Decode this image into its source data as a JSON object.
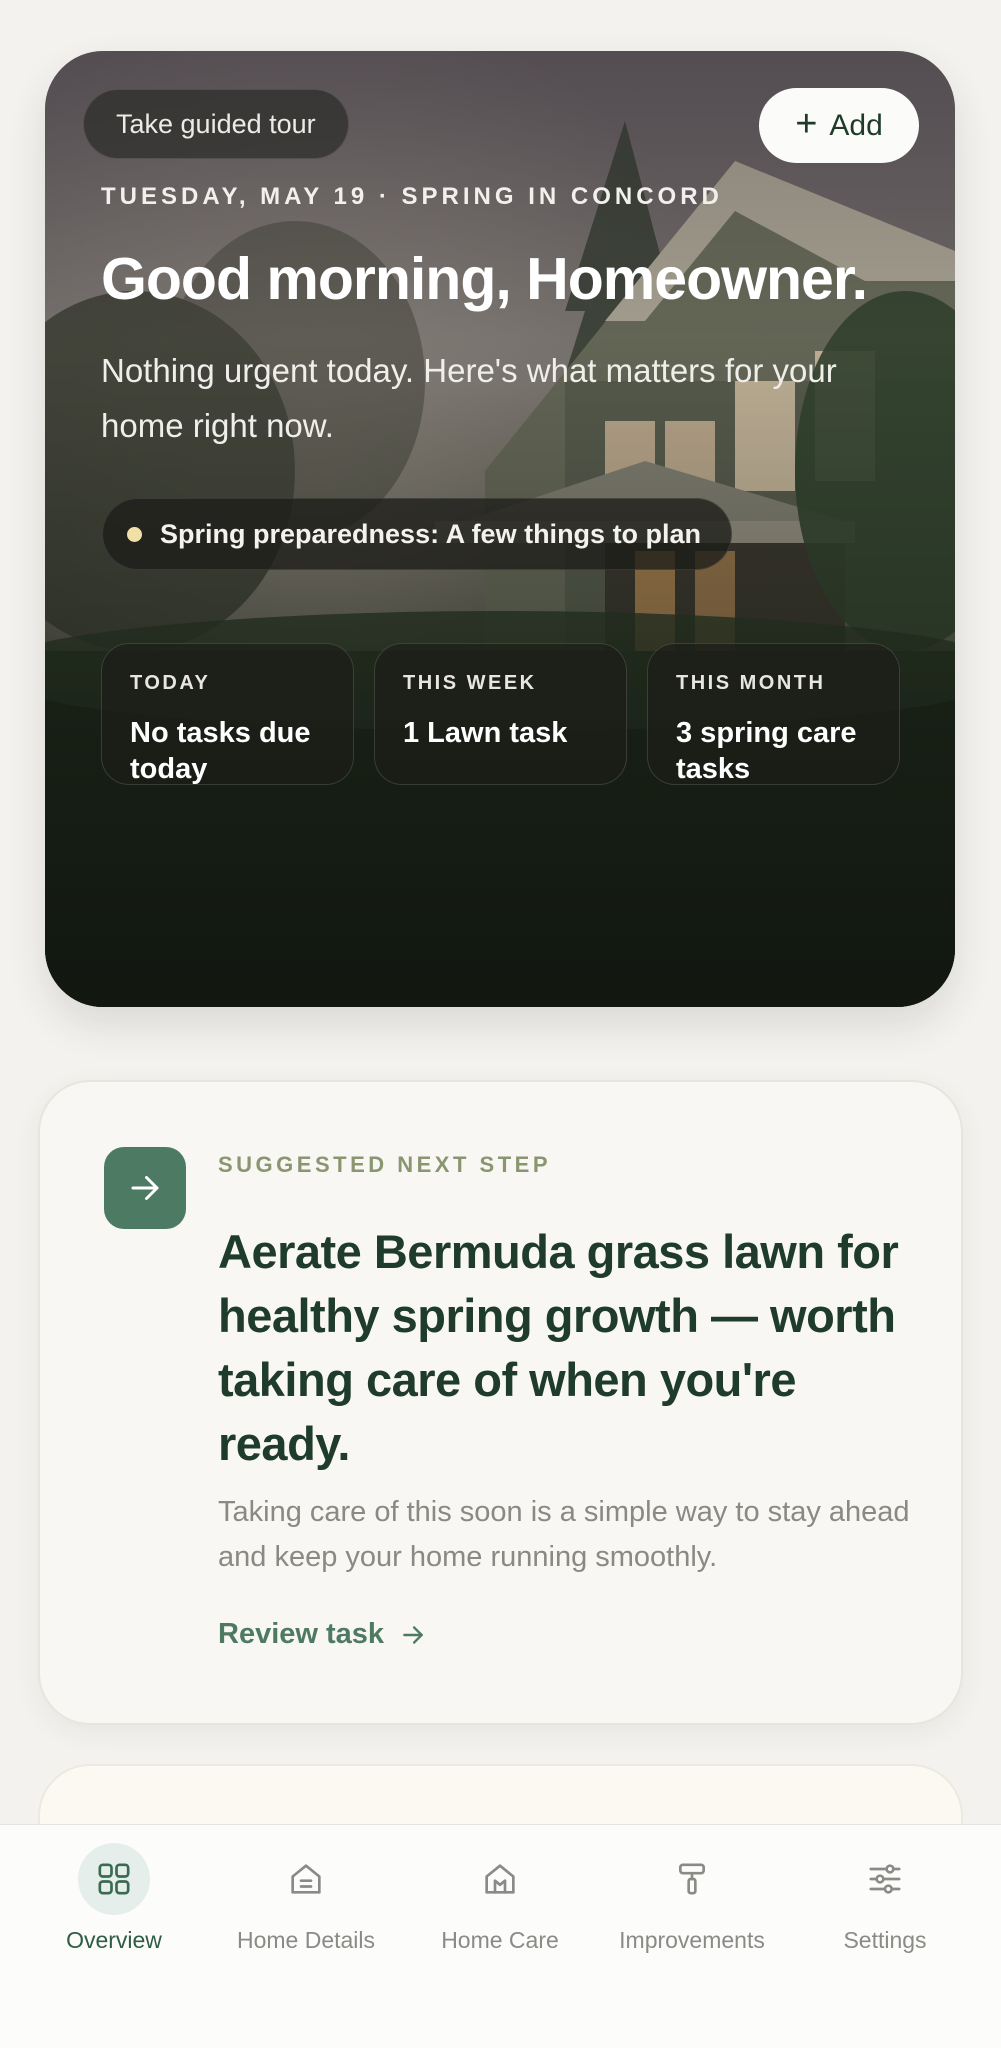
{
  "hero": {
    "tour_label": "Take guided tour",
    "add_label": "Add",
    "date_line": "TUESDAY, MAY 19 · SPRING IN CONCORD",
    "greeting": "Good morning, Homeowner.",
    "subtitle": "Nothing urgent today. Here's what matters for your home right now.",
    "alert": "Spring preparedness: A few things to plan",
    "stats": [
      {
        "label": "TODAY",
        "value": "No tasks due today"
      },
      {
        "label": "THIS WEEK",
        "value": "1 Lawn task"
      },
      {
        "label": "THIS MONTH",
        "value": "3 spring care tasks"
      }
    ]
  },
  "suggestion": {
    "eyebrow": "SUGGESTED NEXT STEP",
    "title": "Aerate Bermuda grass lawn for healthy spring growth — worth taking care of when you're ready.",
    "body": "Taking care of this soon is a simple way to stay ahead and keep your home running smoothly.",
    "link_label": "Review task"
  },
  "nav": {
    "items": [
      {
        "label": "Overview",
        "icon": "grid-icon",
        "active": true
      },
      {
        "label": "Home Details",
        "icon": "house-doc-icon",
        "active": false
      },
      {
        "label": "Home Care",
        "icon": "house-care-icon",
        "active": false
      },
      {
        "label": "Improvements",
        "icon": "paint-roller-icon",
        "active": false
      },
      {
        "label": "Settings",
        "icon": "sliders-icon",
        "active": false
      }
    ]
  },
  "colors": {
    "background": "#f3f2ef",
    "brand_green": "#4d7a63",
    "title_green": "#1e3b2c",
    "eyebrow_olive": "#8a9670",
    "alert_dot": "#f1dfa8",
    "nav_active_bg": "#e5eeea"
  }
}
